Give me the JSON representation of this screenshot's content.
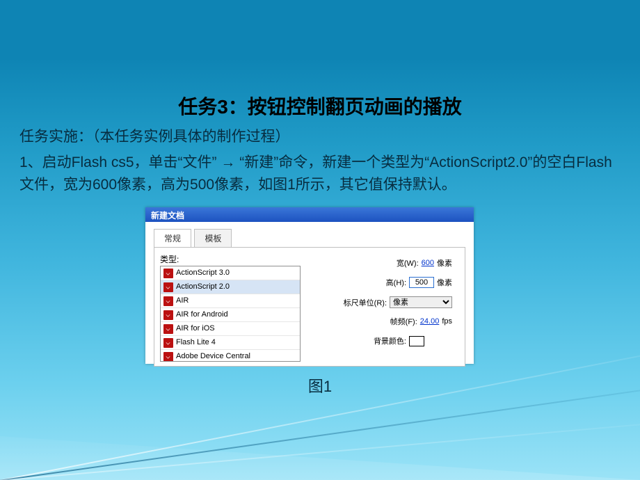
{
  "title": "任务3：按钮控制翻页动画的播放",
  "subtitle": "任务实施：（本任务实例具体的制作过程）",
  "body_parts": {
    "p1a": "1、启动Flash cs5，单击“文件”",
    "arrow": "→",
    "p1b": "“新建”命令，新建一个类型为“ActionScript2.0”的空白Flash文件，宽为600像素，高为500像素，如图1所示，其它值保持默认。"
  },
  "dialog": {
    "titlebar": "新建文档",
    "tabs": {
      "general": "常规",
      "template": "模板"
    },
    "type_label": "类型:",
    "items": [
      "ActionScript 3.0",
      "ActionScript 2.0",
      "AIR",
      "AIR for Android",
      "AIR for iOS",
      "Flash Lite 4",
      "Adobe Device Central"
    ],
    "width": {
      "label": "宽(W):",
      "value": "600",
      "unit": "像素"
    },
    "height": {
      "label": "高(H):",
      "value": "500",
      "unit": "像素"
    },
    "ruler": {
      "label": "标尺单位(R):",
      "value": "像素"
    },
    "fps": {
      "label": "帧频(F):",
      "value": "24.00",
      "unit": "fps"
    },
    "bg": {
      "label": "背景颜色:"
    }
  },
  "caption": "图1"
}
